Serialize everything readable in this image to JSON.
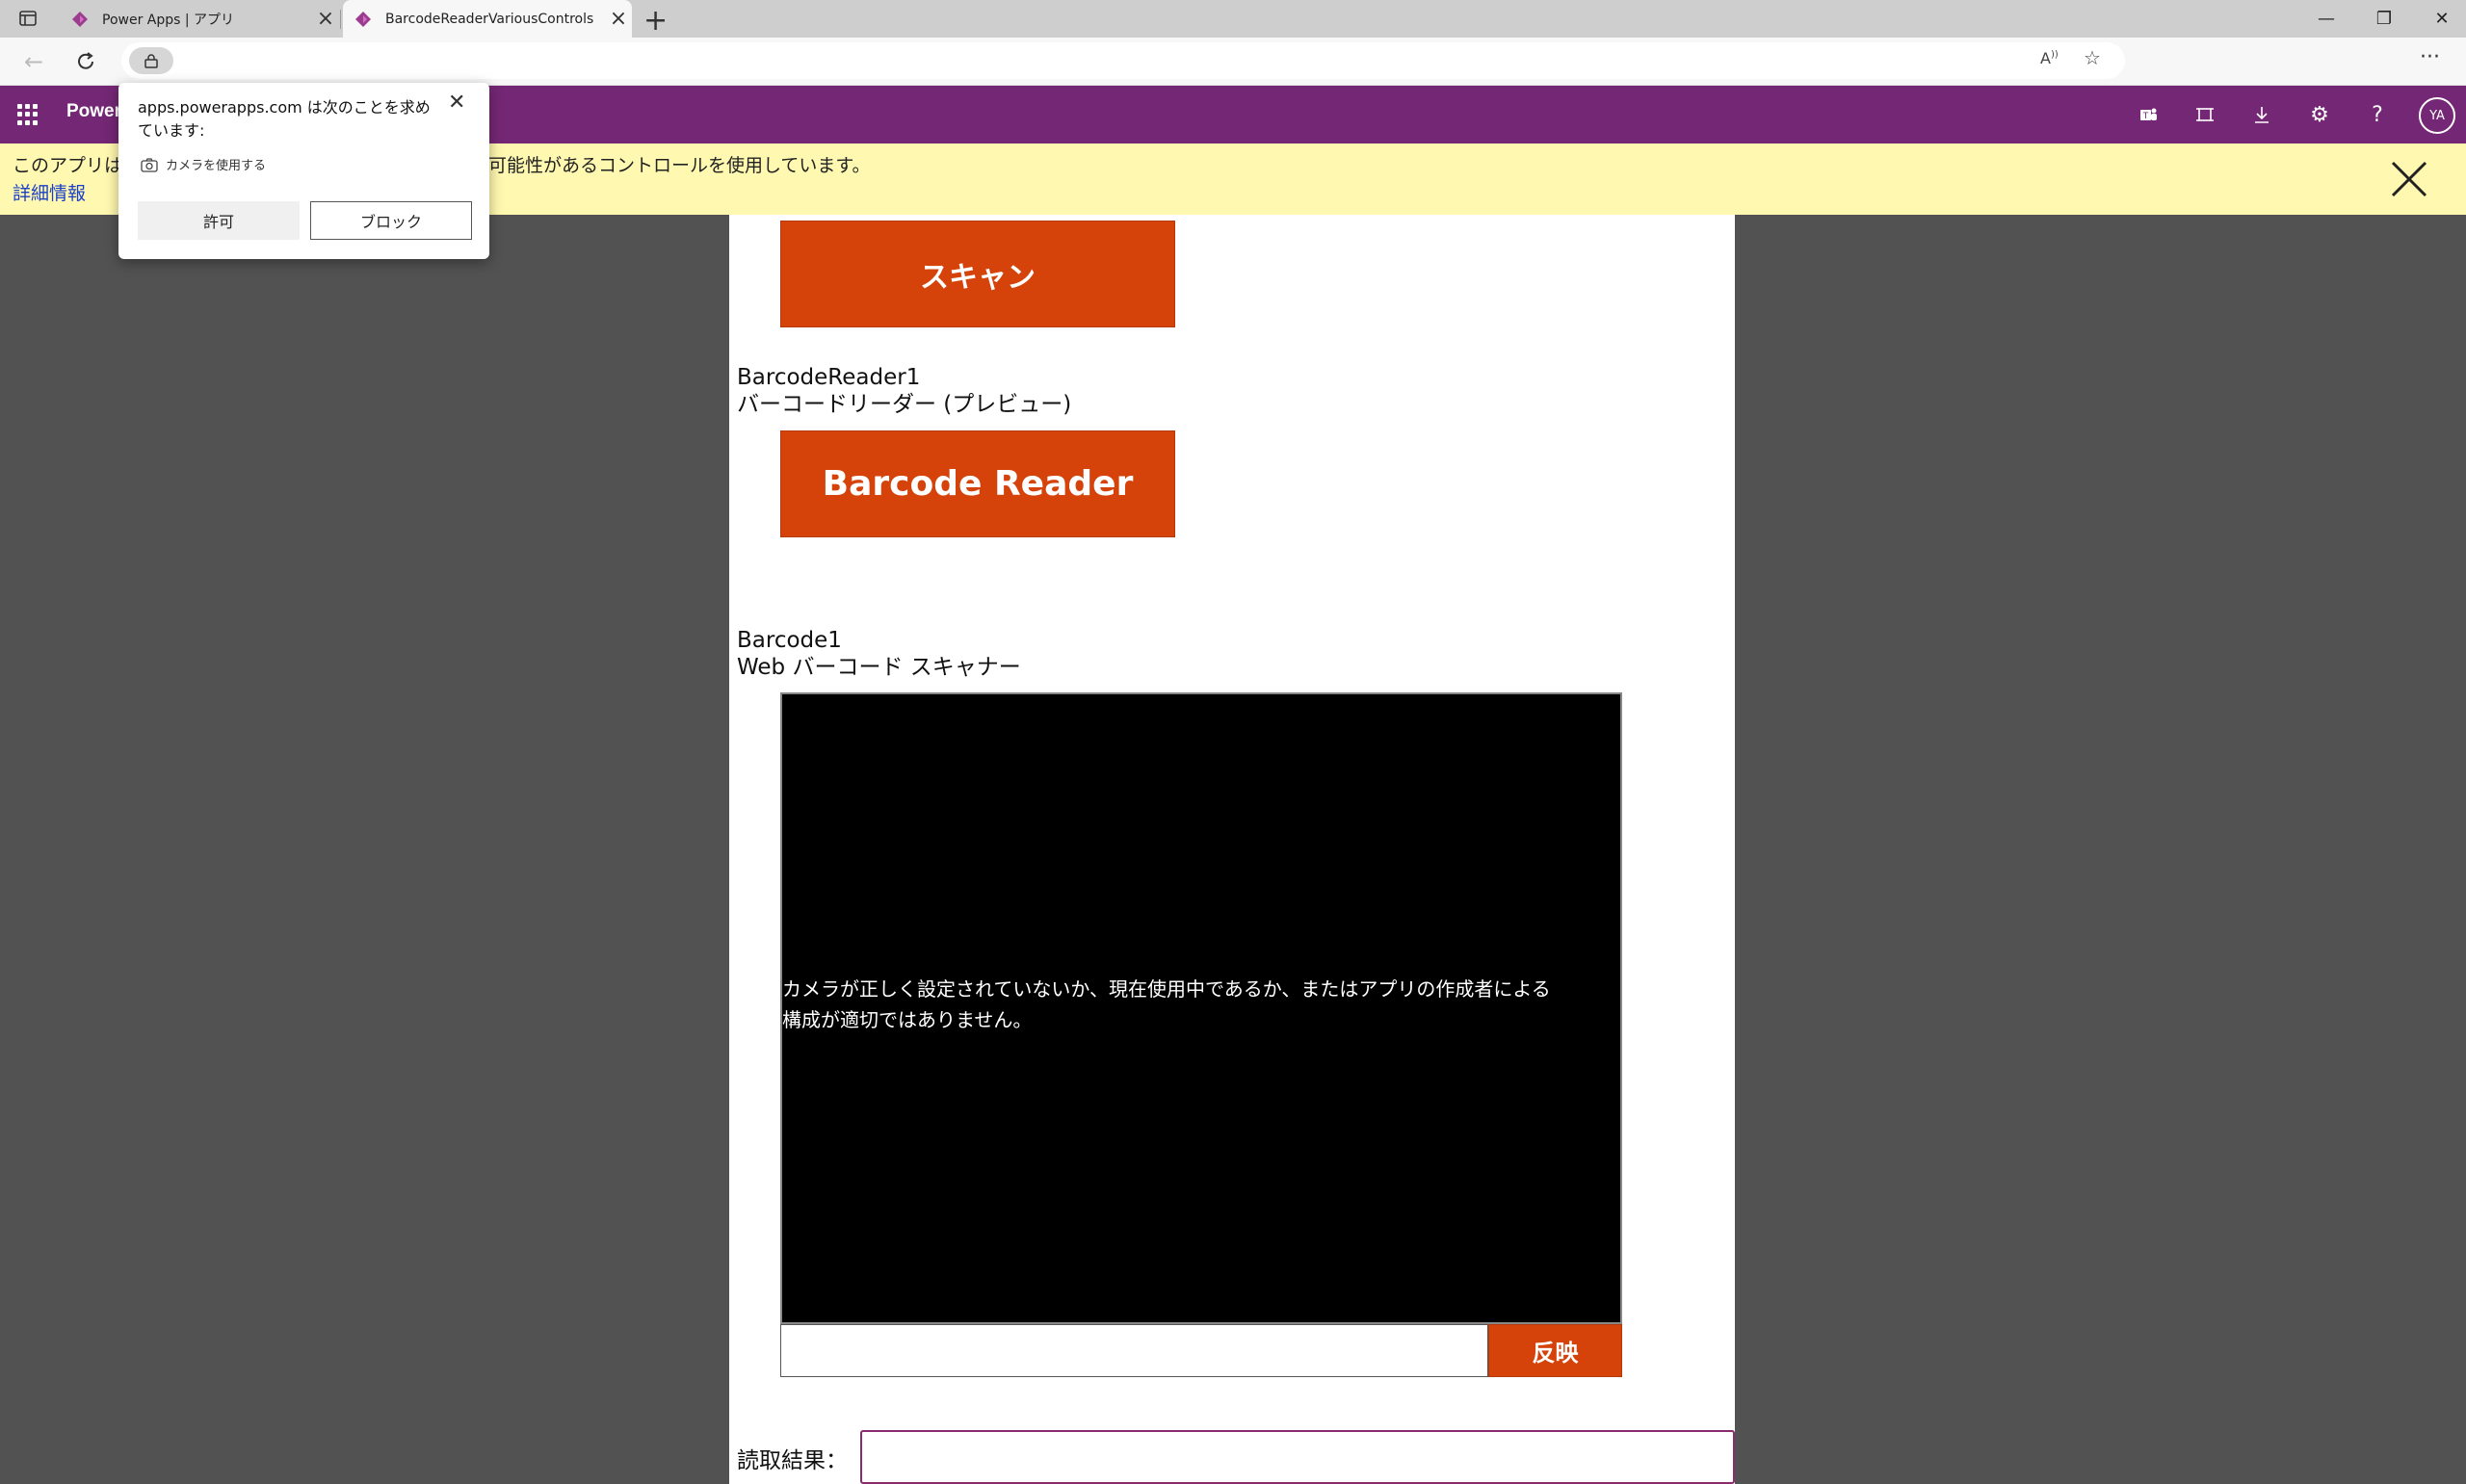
{
  "browser": {
    "tabs": [
      {
        "title": "Power Apps | アプリ",
        "active": false
      },
      {
        "title": "BarcodeReaderVariousControls",
        "active": true
      }
    ],
    "window_controls": {
      "minimize": "—",
      "restore": "❐",
      "close": "✕"
    }
  },
  "header": {
    "app_title": "Power",
    "avatar_initials": "YA",
    "brand_color": "#742774"
  },
  "warning_banner": {
    "text_start": "このアプリは",
    "text_end": "可能性があるコントロールを使用しています。",
    "link_text": "詳細情報"
  },
  "permission_popup": {
    "title": "apps.powerapps.com は次のことを求めています:",
    "camera_request": "カメラを使用する",
    "allow_label": "許可",
    "block_label": "ブロック"
  },
  "app": {
    "scan_button_label": "スキャン",
    "barcode_reader_name": "BarcodeReader1",
    "barcode_reader_type": "バーコードリーダー (プレビュー)",
    "barcode_reader_button_label": "Barcode Reader",
    "barcode_scanner_name": "Barcode1",
    "barcode_scanner_type": "Web バーコード スキャナー",
    "camera_error_line1": "カメラが正しく設定されていないか、現在使用中であるか、またはアプリの作成者による",
    "camera_error_line2": "構成が適切ではありません。",
    "apply_button_label": "反映",
    "result_label": "読取結果："
  },
  "colors": {
    "accent_orange": "#d5430b",
    "banner_yellow": "#fff8b0"
  }
}
